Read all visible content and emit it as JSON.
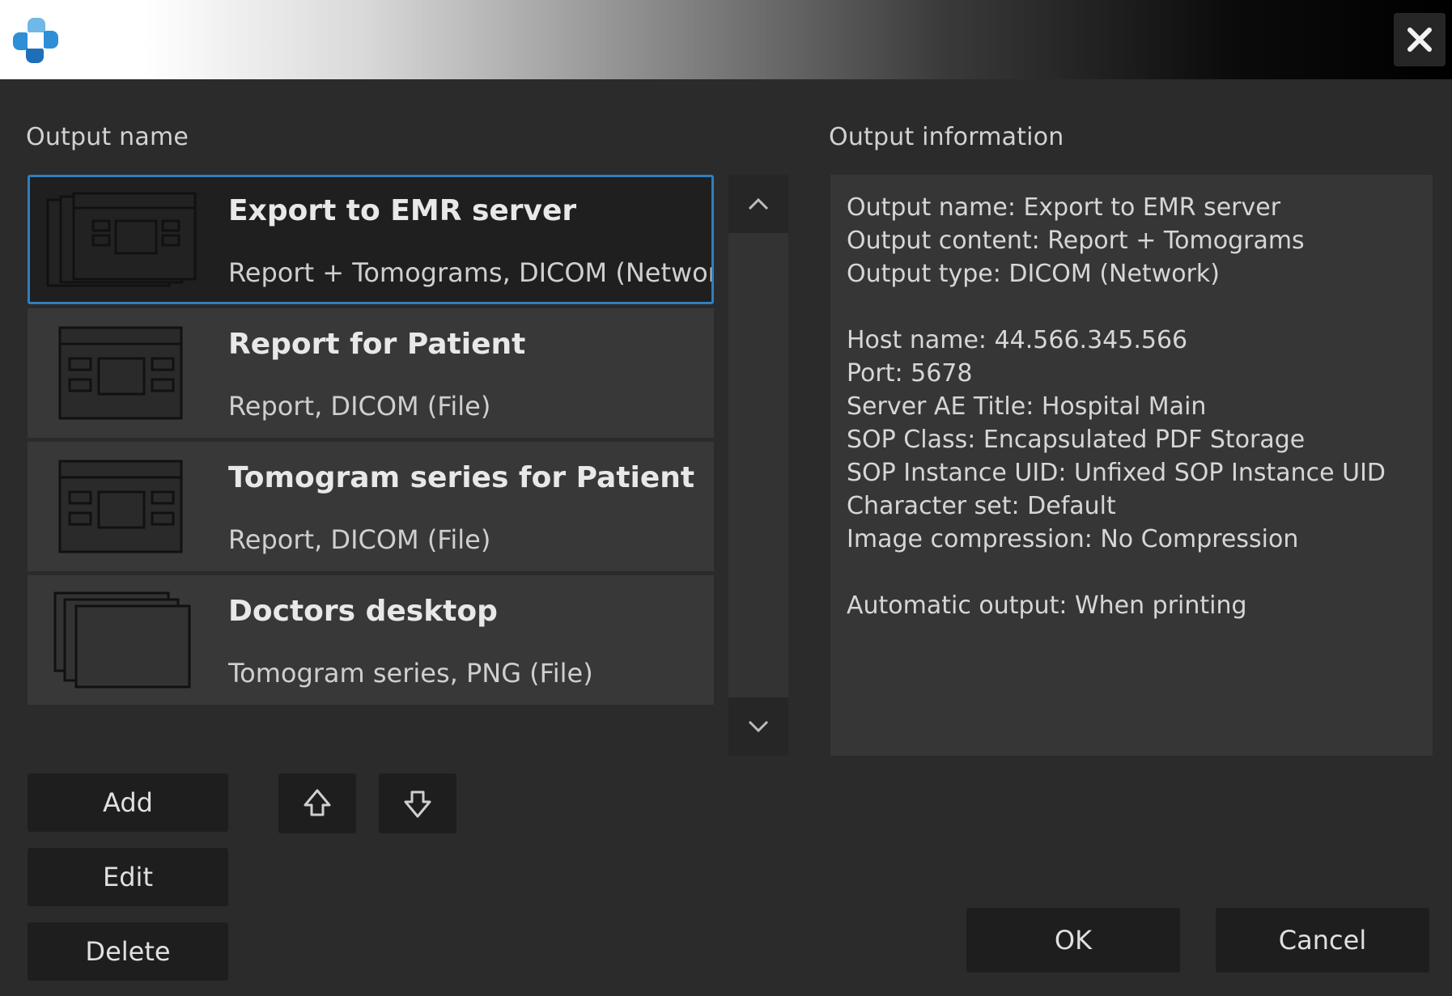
{
  "window": {
    "logo_icon": "app-logo-icon",
    "close_icon": "close-icon"
  },
  "left": {
    "label": "Output name",
    "items": [
      {
        "title": "Export to EMR server",
        "subtitle": "Report + Tomograms, DICOM (Network)",
        "icon": "report-stack-icon",
        "selected": true
      },
      {
        "title": "Report for Patient",
        "subtitle": "Report, DICOM (File)",
        "icon": "report-icon",
        "selected": false
      },
      {
        "title": "Tomogram series for Patient",
        "subtitle": "Report, DICOM (File)",
        "icon": "report-icon",
        "selected": false
      },
      {
        "title": "Doctors desktop",
        "subtitle": "Tomogram series, PNG (File)",
        "icon": "image-stack-icon",
        "selected": false
      }
    ]
  },
  "right": {
    "label": "Output information",
    "lines": [
      "Output name:  Export to EMR server",
      "Output content:  Report + Tomograms",
      "Output type:  DICOM (Network)",
      "",
      "Host name:  44.566.345.566",
      "Port:  5678",
      "Server AE Title:  Hospital Main",
      "SOP Class:  Encapsulated PDF Storage",
      "SOP Instance UID:  Unfixed SOP Instance UID",
      "Character set:  Default",
      "Image compression:  No Compression",
      "",
      "Automatic output:  When printing"
    ]
  },
  "buttons": {
    "add": "Add",
    "edit": "Edit",
    "delete": "Delete",
    "ok": "OK",
    "cancel": "Cancel"
  },
  "colors": {
    "selection_border": "#2e7fc2",
    "background": "#2b2b2b"
  }
}
